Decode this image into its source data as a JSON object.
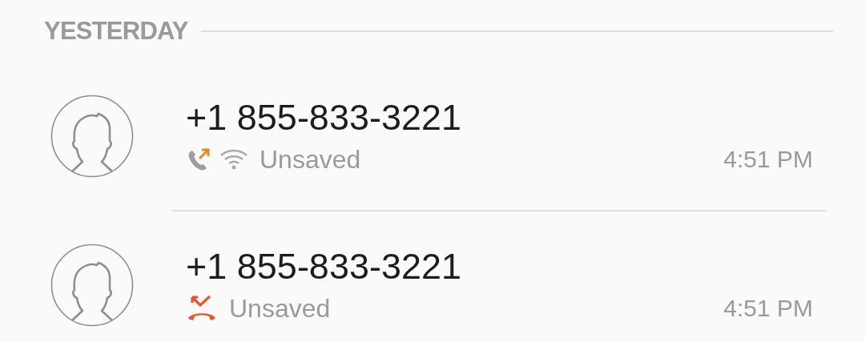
{
  "section_header": "YESTERDAY",
  "calls": [
    {
      "number": "+1 855-833-3221",
      "kind": "outgoing",
      "wifi": true,
      "label": "Unsaved",
      "time": "4:51 PM"
    },
    {
      "number": "+1 855-833-3221",
      "kind": "missed",
      "wifi": false,
      "label": "Unsaved",
      "time": "4:51 PM"
    }
  ]
}
